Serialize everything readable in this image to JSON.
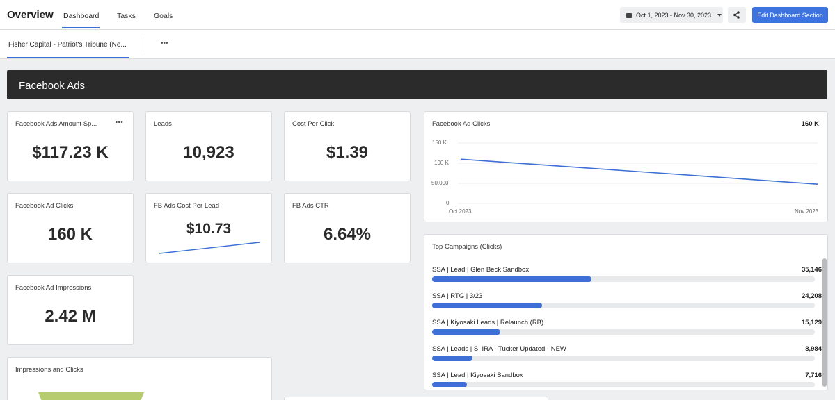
{
  "header": {
    "title": "Overview",
    "tabs": [
      "Dashboard",
      "Tasks",
      "Goals"
    ],
    "date_range": "Oct 1, 2023 - Nov 30, 2023",
    "edit_button": "Edit Dashboard Section"
  },
  "subnav": {
    "client_tab": "Fisher Capital - Patriot's Tribune (Ne...",
    "more": "•••"
  },
  "section": {
    "title": "Facebook Ads"
  },
  "cards": {
    "amount_spent": {
      "label": "Facebook Ads Amount Sp...",
      "value": "$117.23 K",
      "more": "•••"
    },
    "leads": {
      "label": "Leads",
      "value": "10,923"
    },
    "cpc": {
      "label": "Cost Per Click",
      "value": "$1.39"
    },
    "clicks": {
      "label": "Facebook Ad Clicks",
      "value": "160 K"
    },
    "cost_per_lead": {
      "label": "FB Ads Cost Per Lead",
      "value": "$10.73"
    },
    "ctr": {
      "label": "FB Ads CTR",
      "value": "6.64%"
    },
    "impressions": {
      "label": "Facebook Ad Impressions",
      "value": "2.42 M"
    },
    "imp_clicks": {
      "label": "Impressions and Clicks"
    }
  },
  "clicks_chart": {
    "label": "Facebook Ad Clicks",
    "total": "160 K",
    "y_ticks": [
      "150 K",
      "100 K",
      "50,000",
      "0"
    ],
    "x_ticks": [
      "Oct 2023",
      "Nov 2023"
    ]
  },
  "chart_data": {
    "type": "line",
    "title": "Facebook Ad Clicks",
    "x": [
      "Oct 2023",
      "Nov 2023"
    ],
    "series": [
      {
        "values": [
          110000,
          48000
        ]
      }
    ],
    "ylim": [
      0,
      150000
    ],
    "grid": true,
    "line_color": "#3d6fd6"
  },
  "top_campaigns": {
    "label": "Top Campaigns (Clicks)",
    "max": 35146,
    "items": [
      {
        "name": "SSA | Lead | Glen Beck Sandbox",
        "value": 35146,
        "display": "35,146"
      },
      {
        "name": "SSA | RTG | 3/23",
        "value": 24208,
        "display": "24,208"
      },
      {
        "name": "SSA | Kiyosaki Leads | Relaunch (RB)",
        "value": 15129,
        "display": "15,129"
      },
      {
        "name": "SSA | Leads | S. IRA - Tucker Updated - NEW",
        "value": 8984,
        "display": "8,984"
      },
      {
        "name": "SSA | Lead | Kiyosaki Sandbox",
        "value": 7716,
        "display": "7,716"
      }
    ]
  },
  "colors": {
    "accent": "#3d73de",
    "bar": "#3d6fd6",
    "section_bg": "#2b2b2c",
    "funnel": "#b7cc6e"
  }
}
